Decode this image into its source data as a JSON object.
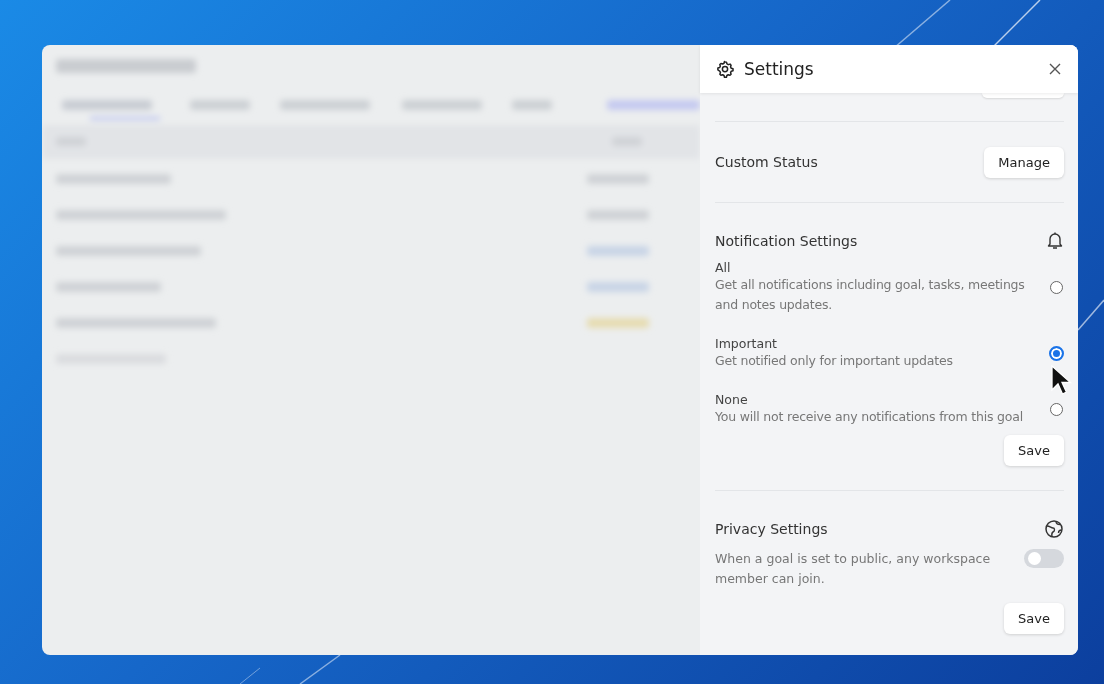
{
  "panel": {
    "title": "Settings"
  },
  "custom_status": {
    "label": "Custom Status",
    "button": "Manage"
  },
  "notifications": {
    "title": "Notification Settings",
    "options": [
      {
        "label": "All",
        "description": "Get all notifications including goal, tasks, meetings and notes updates.",
        "selected": false
      },
      {
        "label": "Important",
        "description": "Get notified only for important updates",
        "selected": true
      },
      {
        "label": "None",
        "description": "You will not receive any notifications from this goal",
        "selected": false
      }
    ],
    "save": "Save"
  },
  "privacy": {
    "title": "Privacy Settings",
    "description": "When a goal is set to public, any workspace member can join.",
    "on": false,
    "save": "Save"
  }
}
